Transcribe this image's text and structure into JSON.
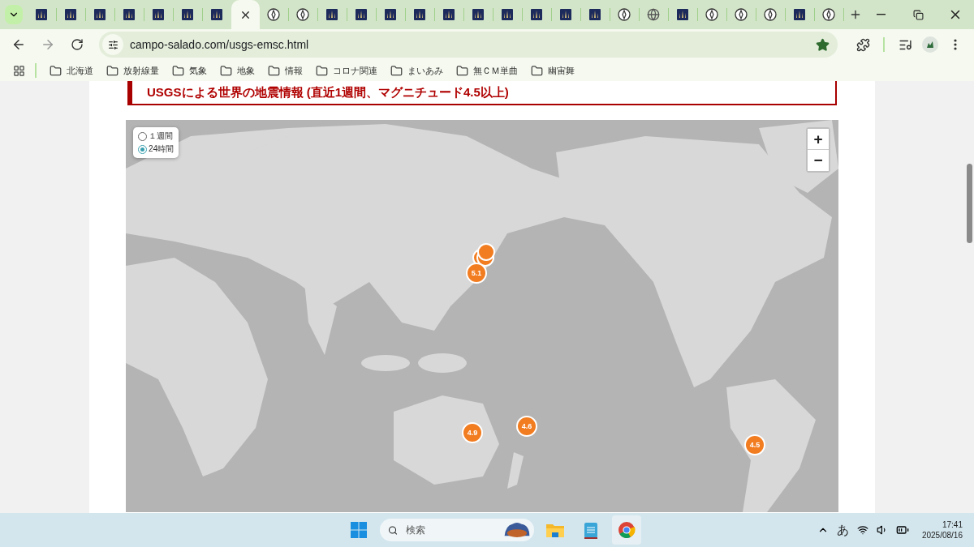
{
  "browser": {
    "tabs": [
      {
        "kind": "vtv",
        "selected": false
      },
      {
        "kind": "vtv",
        "selected": false
      },
      {
        "kind": "vtv",
        "selected": false
      },
      {
        "kind": "vtv",
        "selected": false
      },
      {
        "kind": "vtv",
        "selected": false
      },
      {
        "kind": "vtv",
        "selected": false
      },
      {
        "kind": "vtv",
        "selected": false
      },
      {
        "selected": true
      },
      {
        "kind": "pen",
        "selected": false
      },
      {
        "kind": "pen",
        "selected": false
      },
      {
        "kind": "vtv",
        "selected": false
      },
      {
        "kind": "vtv",
        "selected": false
      },
      {
        "kind": "vtv",
        "selected": false
      },
      {
        "kind": "vtv",
        "selected": false
      },
      {
        "kind": "vtv",
        "selected": false
      },
      {
        "kind": "vtv",
        "selected": false
      },
      {
        "kind": "vtv",
        "selected": false
      },
      {
        "kind": "vtv",
        "selected": false
      },
      {
        "kind": "vtv",
        "selected": false
      },
      {
        "kind": "vtv",
        "selected": false
      },
      {
        "kind": "pen",
        "selected": false
      },
      {
        "kind": "globe",
        "selected": false
      },
      {
        "kind": "vtv",
        "selected": false
      },
      {
        "kind": "pen",
        "selected": false
      },
      {
        "kind": "pen",
        "selected": false
      },
      {
        "kind": "pen",
        "selected": false
      },
      {
        "kind": "vtv",
        "selected": false
      },
      {
        "kind": "pen",
        "selected": false
      }
    ],
    "address": {
      "url": "campo-salado.com/usgs-emsc.html",
      "bookmarked": true
    },
    "bookmarks": [
      {
        "label": "北海道"
      },
      {
        "label": "放射線量"
      },
      {
        "label": "気象"
      },
      {
        "label": "地象"
      },
      {
        "label": "情報"
      },
      {
        "label": "コロナ関連"
      },
      {
        "label": "まいあみ"
      },
      {
        "label": "無ＣＭ単曲"
      },
      {
        "label": "幽宙舞"
      }
    ]
  },
  "page": {
    "heading": "USGSによる世界の地震情報 (直近1週間、マグニチュード4.5以上)",
    "map": {
      "period_options": [
        {
          "label": "１週間",
          "selected": false
        },
        {
          "label": "24時間",
          "selected": true
        }
      ],
      "zoom_controls": [
        "+",
        "−"
      ],
      "markers": [
        {
          "kind": "cluster"
        },
        {
          "kind": "labeled",
          "label": "5.1"
        },
        {
          "kind": "labeled",
          "label": "4.6"
        },
        {
          "kind": "labeled",
          "label": "4.9"
        },
        {
          "kind": "labeled",
          "label": "4.5"
        }
      ]
    }
  },
  "taskbar": {
    "search": {
      "placeholder": "検索"
    },
    "ime": "あ",
    "time": "17:41",
    "date": "2025/08/16"
  }
}
